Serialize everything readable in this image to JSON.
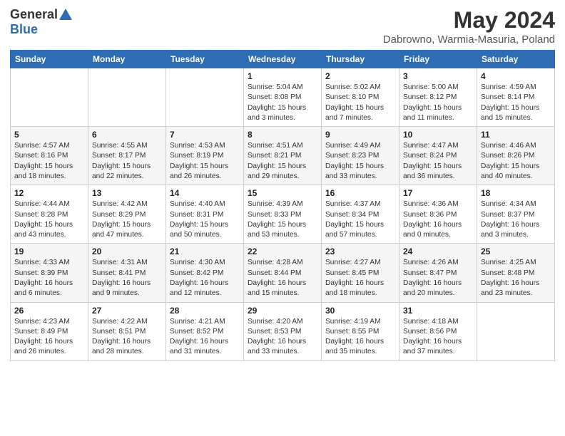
{
  "header": {
    "logo_general": "General",
    "logo_blue": "Blue",
    "main_title": "May 2024",
    "subtitle": "Dabrowno, Warmia-Masuria, Poland"
  },
  "weekdays": [
    "Sunday",
    "Monday",
    "Tuesday",
    "Wednesday",
    "Thursday",
    "Friday",
    "Saturday"
  ],
  "weeks": [
    [
      {
        "day": "",
        "info": ""
      },
      {
        "day": "",
        "info": ""
      },
      {
        "day": "",
        "info": ""
      },
      {
        "day": "1",
        "info": "Sunrise: 5:04 AM\nSunset: 8:08 PM\nDaylight: 15 hours\nand 3 minutes."
      },
      {
        "day": "2",
        "info": "Sunrise: 5:02 AM\nSunset: 8:10 PM\nDaylight: 15 hours\nand 7 minutes."
      },
      {
        "day": "3",
        "info": "Sunrise: 5:00 AM\nSunset: 8:12 PM\nDaylight: 15 hours\nand 11 minutes."
      },
      {
        "day": "4",
        "info": "Sunrise: 4:59 AM\nSunset: 8:14 PM\nDaylight: 15 hours\nand 15 minutes."
      }
    ],
    [
      {
        "day": "5",
        "info": "Sunrise: 4:57 AM\nSunset: 8:16 PM\nDaylight: 15 hours\nand 18 minutes."
      },
      {
        "day": "6",
        "info": "Sunrise: 4:55 AM\nSunset: 8:17 PM\nDaylight: 15 hours\nand 22 minutes."
      },
      {
        "day": "7",
        "info": "Sunrise: 4:53 AM\nSunset: 8:19 PM\nDaylight: 15 hours\nand 26 minutes."
      },
      {
        "day": "8",
        "info": "Sunrise: 4:51 AM\nSunset: 8:21 PM\nDaylight: 15 hours\nand 29 minutes."
      },
      {
        "day": "9",
        "info": "Sunrise: 4:49 AM\nSunset: 8:23 PM\nDaylight: 15 hours\nand 33 minutes."
      },
      {
        "day": "10",
        "info": "Sunrise: 4:47 AM\nSunset: 8:24 PM\nDaylight: 15 hours\nand 36 minutes."
      },
      {
        "day": "11",
        "info": "Sunrise: 4:46 AM\nSunset: 8:26 PM\nDaylight: 15 hours\nand 40 minutes."
      }
    ],
    [
      {
        "day": "12",
        "info": "Sunrise: 4:44 AM\nSunset: 8:28 PM\nDaylight: 15 hours\nand 43 minutes."
      },
      {
        "day": "13",
        "info": "Sunrise: 4:42 AM\nSunset: 8:29 PM\nDaylight: 15 hours\nand 47 minutes."
      },
      {
        "day": "14",
        "info": "Sunrise: 4:40 AM\nSunset: 8:31 PM\nDaylight: 15 hours\nand 50 minutes."
      },
      {
        "day": "15",
        "info": "Sunrise: 4:39 AM\nSunset: 8:33 PM\nDaylight: 15 hours\nand 53 minutes."
      },
      {
        "day": "16",
        "info": "Sunrise: 4:37 AM\nSunset: 8:34 PM\nDaylight: 15 hours\nand 57 minutes."
      },
      {
        "day": "17",
        "info": "Sunrise: 4:36 AM\nSunset: 8:36 PM\nDaylight: 16 hours\nand 0 minutes."
      },
      {
        "day": "18",
        "info": "Sunrise: 4:34 AM\nSunset: 8:37 PM\nDaylight: 16 hours\nand 3 minutes."
      }
    ],
    [
      {
        "day": "19",
        "info": "Sunrise: 4:33 AM\nSunset: 8:39 PM\nDaylight: 16 hours\nand 6 minutes."
      },
      {
        "day": "20",
        "info": "Sunrise: 4:31 AM\nSunset: 8:41 PM\nDaylight: 16 hours\nand 9 minutes."
      },
      {
        "day": "21",
        "info": "Sunrise: 4:30 AM\nSunset: 8:42 PM\nDaylight: 16 hours\nand 12 minutes."
      },
      {
        "day": "22",
        "info": "Sunrise: 4:28 AM\nSunset: 8:44 PM\nDaylight: 16 hours\nand 15 minutes."
      },
      {
        "day": "23",
        "info": "Sunrise: 4:27 AM\nSunset: 8:45 PM\nDaylight: 16 hours\nand 18 minutes."
      },
      {
        "day": "24",
        "info": "Sunrise: 4:26 AM\nSunset: 8:47 PM\nDaylight: 16 hours\nand 20 minutes."
      },
      {
        "day": "25",
        "info": "Sunrise: 4:25 AM\nSunset: 8:48 PM\nDaylight: 16 hours\nand 23 minutes."
      }
    ],
    [
      {
        "day": "26",
        "info": "Sunrise: 4:23 AM\nSunset: 8:49 PM\nDaylight: 16 hours\nand 26 minutes."
      },
      {
        "day": "27",
        "info": "Sunrise: 4:22 AM\nSunset: 8:51 PM\nDaylight: 16 hours\nand 28 minutes."
      },
      {
        "day": "28",
        "info": "Sunrise: 4:21 AM\nSunset: 8:52 PM\nDaylight: 16 hours\nand 31 minutes."
      },
      {
        "day": "29",
        "info": "Sunrise: 4:20 AM\nSunset: 8:53 PM\nDaylight: 16 hours\nand 33 minutes."
      },
      {
        "day": "30",
        "info": "Sunrise: 4:19 AM\nSunset: 8:55 PM\nDaylight: 16 hours\nand 35 minutes."
      },
      {
        "day": "31",
        "info": "Sunrise: 4:18 AM\nSunset: 8:56 PM\nDaylight: 16 hours\nand 37 minutes."
      },
      {
        "day": "",
        "info": ""
      }
    ]
  ],
  "row_styles": [
    "row-white",
    "row-alt",
    "row-white",
    "row-alt",
    "row-white"
  ]
}
